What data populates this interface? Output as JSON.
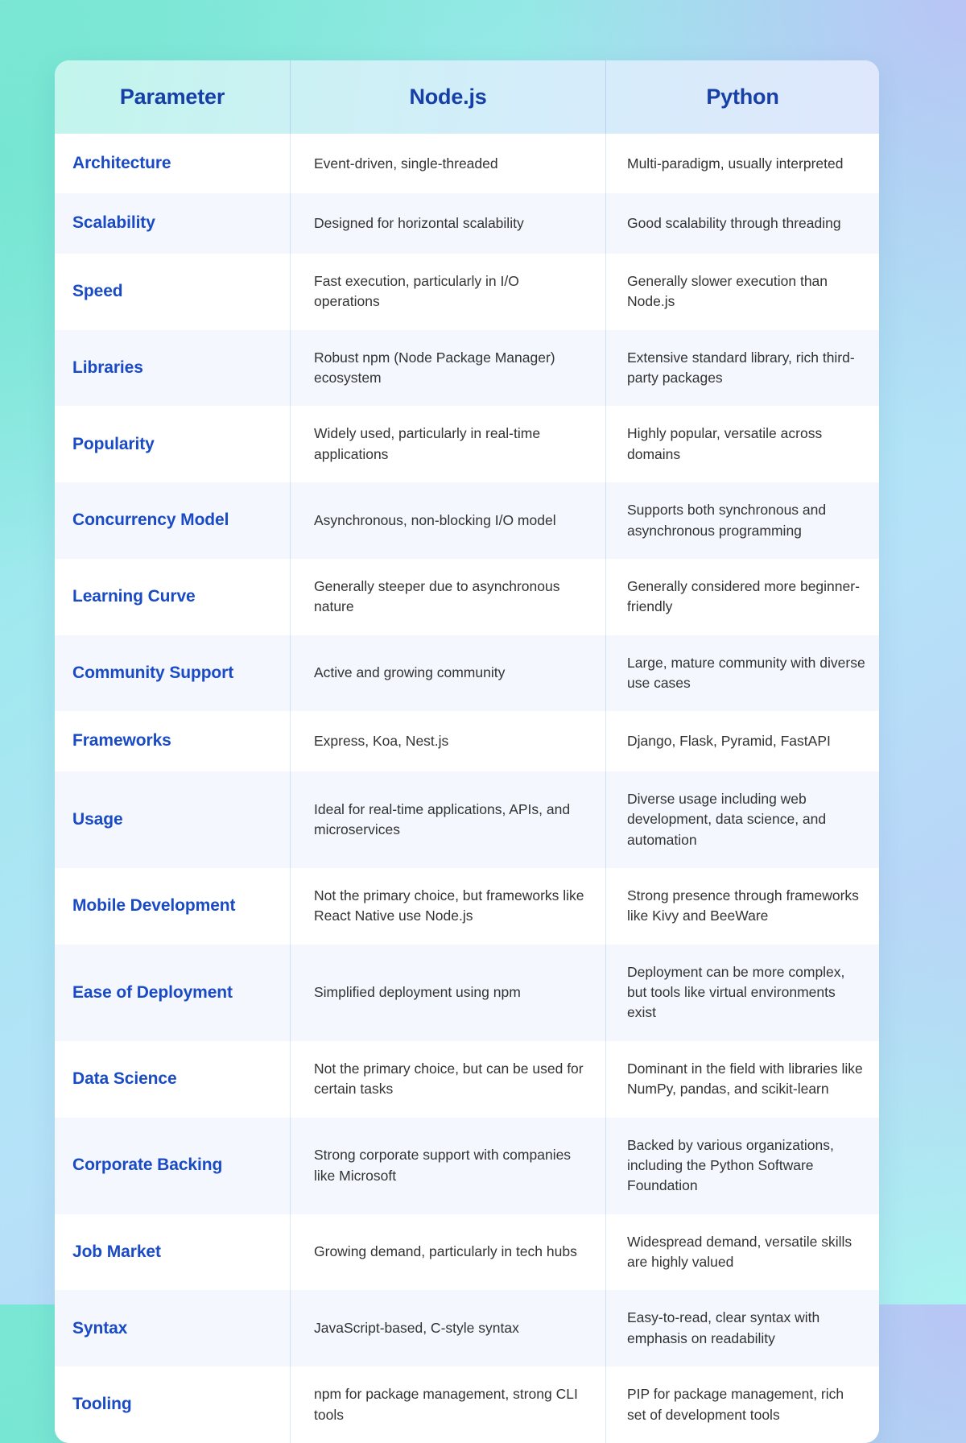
{
  "table": {
    "headers": {
      "parameter": "Parameter",
      "node": "Node.js",
      "python": "Python"
    },
    "colors": {
      "header_text": "#173fa8",
      "parameter_text": "#1a4bc4",
      "body_text": "#333333",
      "row_alt_bg": "#f4f7fe",
      "row_bg": "#ffffff",
      "page_gradient_from": "#7ee8d5",
      "page_gradient_to": "#bcc8f7"
    },
    "rows": [
      {
        "parameter": "Architecture",
        "node": "Event-driven, single-threaded",
        "python": "Multi-paradigm, usually interpreted"
      },
      {
        "parameter": "Scalability",
        "node": "Designed for horizontal scalability",
        "python": "Good scalability through threading"
      },
      {
        "parameter": "Speed",
        "node": "Fast execution, particularly in I/O operations",
        "python": "Generally slower execution than Node.js"
      },
      {
        "parameter": "Libraries",
        "node": "Robust npm (Node Package Manager) ecosystem",
        "python": "Extensive standard library, rich third-party packages"
      },
      {
        "parameter": "Popularity",
        "node": "Widely used, particularly in real-time applications",
        "python": "Highly popular, versatile across domains"
      },
      {
        "parameter": "Concurrency Model",
        "node": "Asynchronous, non-blocking I/O model",
        "python": "Supports both synchronous and asynchronous programming"
      },
      {
        "parameter": "Learning Curve",
        "node": "Generally steeper due to asynchronous nature",
        "python": "Generally considered more beginner-friendly"
      },
      {
        "parameter": "Community Support",
        "node": "Active and growing community",
        "python": "Large, mature community with diverse use cases"
      },
      {
        "parameter": "Frameworks",
        "node": "Express, Koa, Nest.js",
        "python": "Django, Flask, Pyramid, FastAPI"
      },
      {
        "parameter": "Usage",
        "node": "Ideal for real-time applications, APIs, and microservices",
        "python": "Diverse usage including web development, data science, and automation"
      },
      {
        "parameter": "Mobile Development",
        "node": "Not the primary choice, but frameworks like React Native use Node.js",
        "python": "Strong presence through frameworks like Kivy and BeeWare"
      },
      {
        "parameter": "Ease of Deployment",
        "node": "Simplified deployment using npm",
        "python": "Deployment can be more complex, but tools like virtual environments exist"
      },
      {
        "parameter": "Data Science",
        "node": "Not the primary choice, but can be used for certain tasks",
        "python": "Dominant in the field with libraries like NumPy, pandas, and scikit-learn"
      },
      {
        "parameter": "Corporate Backing",
        "node": "Strong corporate support with companies like Microsoft",
        "python": "Backed by various organizations, including the Python Software Foundation"
      },
      {
        "parameter": "Job Market",
        "node": "Growing demand, particularly in tech hubs",
        "python": "Widespread demand, versatile skills are highly valued"
      },
      {
        "parameter": "Syntax",
        "node": "JavaScript-based, C-style syntax",
        "python": "Easy-to-read, clear syntax with emphasis on readability"
      },
      {
        "parameter": "Tooling",
        "node": "npm for package management, strong CLI tools",
        "python": "PIP for package management, rich set of development tools"
      }
    ]
  }
}
